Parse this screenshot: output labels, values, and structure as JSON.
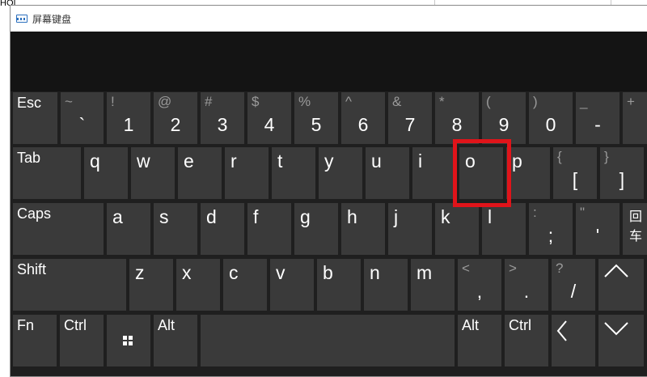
{
  "background": {
    "partial_text": "HOI"
  },
  "window": {
    "title": "屏幕键盘",
    "icon": "keyboard-icon"
  },
  "colors": {
    "key_bg": "#3a3a3a",
    "keyboard_bg": "#1f1f1f",
    "highlight": "#e0141a"
  },
  "rows": {
    "row1": {
      "esc": "Esc",
      "keys": [
        {
          "shift": "~",
          "main": "`"
        },
        {
          "shift": "!",
          "main": "1"
        },
        {
          "shift": "@",
          "main": "2"
        },
        {
          "shift": "#",
          "main": "3"
        },
        {
          "shift": "$",
          "main": "4"
        },
        {
          "shift": "%",
          "main": "5"
        },
        {
          "shift": "^",
          "main": "6"
        },
        {
          "shift": "&",
          "main": "7"
        },
        {
          "shift": "*",
          "main": "8"
        },
        {
          "shift": "(",
          "main": "9"
        },
        {
          "shift": ")",
          "main": "0"
        },
        {
          "shift": "_",
          "main": "-"
        },
        {
          "shift": "+",
          "main": ""
        }
      ]
    },
    "row2": {
      "tab": "Tab",
      "letters": [
        "q",
        "w",
        "e",
        "r",
        "t",
        "y",
        "u",
        "i",
        "o",
        "p"
      ],
      "brackets": [
        {
          "shift": "{",
          "main": "["
        },
        {
          "shift": "}",
          "main": "]"
        }
      ]
    },
    "row3": {
      "caps": "Caps",
      "letters": [
        "a",
        "s",
        "d",
        "f",
        "g",
        "h",
        "j",
        "k",
        "l"
      ],
      "punct": [
        {
          "shift": ":",
          "main": ";"
        },
        {
          "shift": "\"",
          "main": "'"
        }
      ],
      "enter_partial": "回车"
    },
    "row4": {
      "shift": "Shift",
      "letters": [
        "z",
        "x",
        "c",
        "v",
        "b",
        "n",
        "m"
      ],
      "punct": [
        {
          "shift": "<",
          "main": ","
        },
        {
          "shift": ">",
          "main": "."
        },
        {
          "shift": "?",
          "main": "/"
        }
      ],
      "up_icon": "arrow-up-icon"
    },
    "row5": {
      "fn": "Fn",
      "ctrl_left": "Ctrl",
      "win_icon": "windows-logo-icon",
      "alt_left": "Alt",
      "alt_right": "Alt",
      "ctrl_right": "Ctrl",
      "left_icon": "arrow-left-icon",
      "down_icon": "arrow-down-icon"
    }
  },
  "highlighted_key": "o"
}
